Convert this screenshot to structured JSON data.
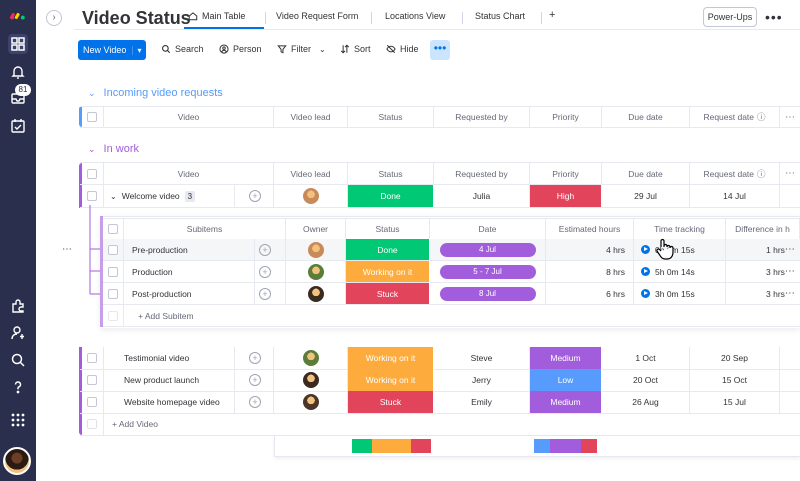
{
  "rail": {
    "notifications_badge": "81",
    "icons": [
      "monday-logo-icon",
      "home-grid-icon",
      "bell-icon",
      "inbox-icon",
      "my-work-icon",
      "integrations-icon",
      "invite-user-icon",
      "search-icon",
      "help-icon",
      "apps-icon"
    ]
  },
  "header": {
    "title": "Video Status",
    "tabs": [
      {
        "label": "Main Table",
        "active": true
      },
      {
        "label": "Video Request Form"
      },
      {
        "label": "Locations View"
      },
      {
        "label": "Status Chart"
      },
      {
        "label": "+"
      }
    ],
    "powerups": "Power-Ups",
    "more": "•••"
  },
  "toolbar": {
    "new_item": "New Video",
    "search": "Search",
    "person": "Person",
    "filter": "Filter",
    "sort": "Sort",
    "hide": "Hide",
    "more": "•••"
  },
  "columns": {
    "video": "Video",
    "video_lead": "Video lead",
    "status": "Status",
    "requested_by": "Requested by",
    "priority": "Priority",
    "due_date": "Due date",
    "request_date": "Request date"
  },
  "groups": [
    {
      "title": "Incoming video requests",
      "color": "#579bfc"
    },
    {
      "title": "In work",
      "color": "#a25ddc"
    }
  ],
  "in_work": {
    "rows": [
      {
        "video": "Welcome video",
        "subitem_count": "3",
        "status": "Done",
        "status_color": "#00c875",
        "requested_by": "Julia",
        "priority": "High",
        "priority_color": "#e2445c",
        "due": "29 Jul",
        "request": "14 Jul",
        "avatar_color": "#c98a5a"
      },
      {
        "video": "Testimonial video",
        "status": "Working on it",
        "status_color": "#fdab3d",
        "requested_by": "Steve",
        "priority": "Medium",
        "priority_color": "#a25ddc",
        "due": "1 Oct",
        "request": "20 Sep",
        "avatar_color": "#5a7d3a"
      },
      {
        "video": "New product launch",
        "status": "Working on it",
        "status_color": "#fdab3d",
        "requested_by": "Jerry",
        "priority": "Low",
        "priority_color": "#579bfc",
        "due": "20 Oct",
        "request": "15 Oct",
        "avatar_color": "#3b2a20"
      },
      {
        "video": "Website homepage video",
        "status": "Stuck",
        "status_color": "#e2445c",
        "requested_by": "Emily",
        "priority": "Medium",
        "priority_color": "#a25ddc",
        "due": "26 Aug",
        "request": "15 Jul",
        "avatar_color": "#4a3528"
      }
    ],
    "add_item": "+ Add Video"
  },
  "subitems": {
    "columns": {
      "subitems": "Subitems",
      "owner": "Owner",
      "status": "Status",
      "date": "Date",
      "estimated_hours": "Estimated hours",
      "time_tracking": "Time tracking",
      "difference": "Difference in h"
    },
    "rows": [
      {
        "name": "Pre-production",
        "status": "Done",
        "status_color": "#00c875",
        "date": "4 Jul",
        "hours": "4 hrs",
        "time": "0h 0m 15s",
        "diff": "1 hrs",
        "avatar_color": "#c98a5a"
      },
      {
        "name": "Production",
        "status": "Working on it",
        "status_color": "#fdab3d",
        "date": "5 - 7 Jul",
        "hours": "8 hrs",
        "time": "5h 0m 14s",
        "diff": "3 hrs",
        "avatar_color": "#5a7d3a"
      },
      {
        "name": "Post-production",
        "status": "Stuck",
        "status_color": "#e2445c",
        "date": "8 Jul",
        "hours": "6 hrs",
        "time": "3h 0m 15s",
        "diff": "3 hrs",
        "avatar_color": "#3b2a20"
      }
    ],
    "add_subitem": "+ Add Subitem"
  },
  "summary": {
    "status_segments": [
      {
        "color": "#00c875",
        "fraction": 0.25
      },
      {
        "color": "#fdab3d",
        "fraction": 0.5
      },
      {
        "color": "#e2445c",
        "fraction": 0.25
      }
    ],
    "priority_segments": [
      {
        "color": "#579bfc",
        "fraction": 0.25
      },
      {
        "color": "#a25ddc",
        "fraction": 0.5
      },
      {
        "color": "#e2445c",
        "fraction": 0.25
      }
    ]
  }
}
